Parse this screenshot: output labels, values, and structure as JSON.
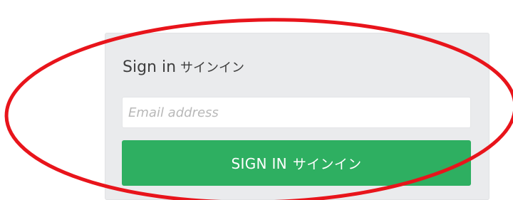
{
  "signin_panel": {
    "title": "Sign in",
    "title_jp": "サインイン",
    "email_placeholder": "Email address",
    "email_value": "",
    "button_label": "SIGN IN",
    "button_label_jp": "サインイン"
  },
  "colors": {
    "panel_background": "#eaebed",
    "button_background": "#2eaf61",
    "button_text": "#ffffff",
    "highlight_ellipse": "#e8141b"
  }
}
